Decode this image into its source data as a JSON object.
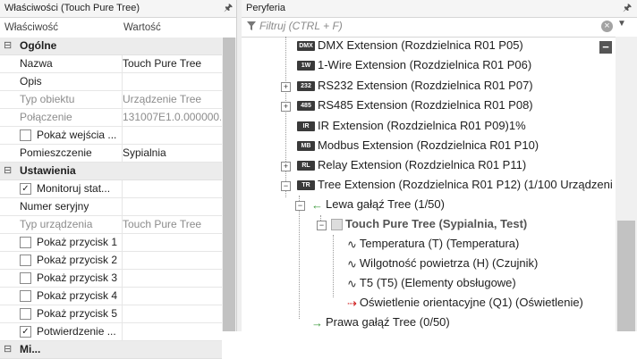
{
  "left_panel": {
    "title": "Właściwości (Touch Pure Tree)",
    "col_property": "Właściwość",
    "col_value": "Wartość",
    "categories": {
      "general": "Ogólne",
      "settings": "Ustawienia",
      "bottom_partial": "Mi..."
    },
    "rows": {
      "name": {
        "label": "Nazwa",
        "value": "Touch Pure Tree"
      },
      "desc": {
        "label": "Opis",
        "value": ""
      },
      "type": {
        "label": "Typ obiektu",
        "value": "Urządzenie Tree"
      },
      "conn": {
        "label": "Połączenie",
        "value": "131007E1.0.000000..."
      },
      "inputs": {
        "label": "Pokaż wejścia ...",
        "value": ""
      },
      "room": {
        "label": "Pomieszczenie",
        "value": "Sypialnia"
      },
      "monitor": {
        "label": "Monitoruj stat...",
        "value": ""
      },
      "serial": {
        "label": "Numer seryjny",
        "value": ""
      },
      "devtype": {
        "label": "Typ urządzenia",
        "value": "Touch Pure Tree"
      },
      "btn1": {
        "label": "Pokaż przycisk 1",
        "value": ""
      },
      "btn2": {
        "label": "Pokaż przycisk 2",
        "value": ""
      },
      "btn3": {
        "label": "Pokaż przycisk 3",
        "value": ""
      },
      "btn4": {
        "label": "Pokaż przycisk 4",
        "value": ""
      },
      "btn5": {
        "label": "Pokaż przycisk 5",
        "value": ""
      },
      "confirm": {
        "label": "Potwierdzenie ...",
        "value": ""
      }
    }
  },
  "right_panel": {
    "title": "Peryferia",
    "filter_placeholder": "Filtruj (CTRL + F)",
    "nodes": {
      "dmx": "DMX Extension (Rozdzielnica R01 P05)",
      "onewire": "1-Wire Extension (Rozdzielnica R01 P06)",
      "rs232": "RS232 Extension (Rozdzielnica R01 P07)",
      "rs485": "RS485 Extension (Rozdzielnica R01 P08)",
      "ir": "IR Extension (Rozdzielnica R01 P09)1%",
      "modbus": "Modbus Extension (Rozdzielnica R01 P10)",
      "relay": "Relay Extension (Rozdzielnica R01 P11)",
      "tree": "Tree Extension (Rozdzielnica R01 P12) (1/100 Urządzeni",
      "left_branch": "Lewa gałąź Tree (1/50)",
      "touch": "Touch Pure Tree (Sypialnia, Test)",
      "temp": "Temperatura (T) (Temperatura)",
      "humid": "Wilgotność powietrza (H) (Czujnik)",
      "t5": "T5 (T5) (Elementy obsługowe)",
      "light": "Oświetlenie orientacyjne (Q1) (Oświetlenie)",
      "right_branch": "Prawa gałąź Tree (0/50)"
    },
    "badges": {
      "dmx": "DMX",
      "onewire": "1W",
      "rs232": "232",
      "rs485": "485",
      "ir": "IR",
      "modbus": "MB",
      "relay": "RL",
      "tree": "TR"
    }
  },
  "colors": {
    "accent_green": "#3c9a3c",
    "sensor_orange": "#e0a020",
    "output_red": "#d02020"
  }
}
